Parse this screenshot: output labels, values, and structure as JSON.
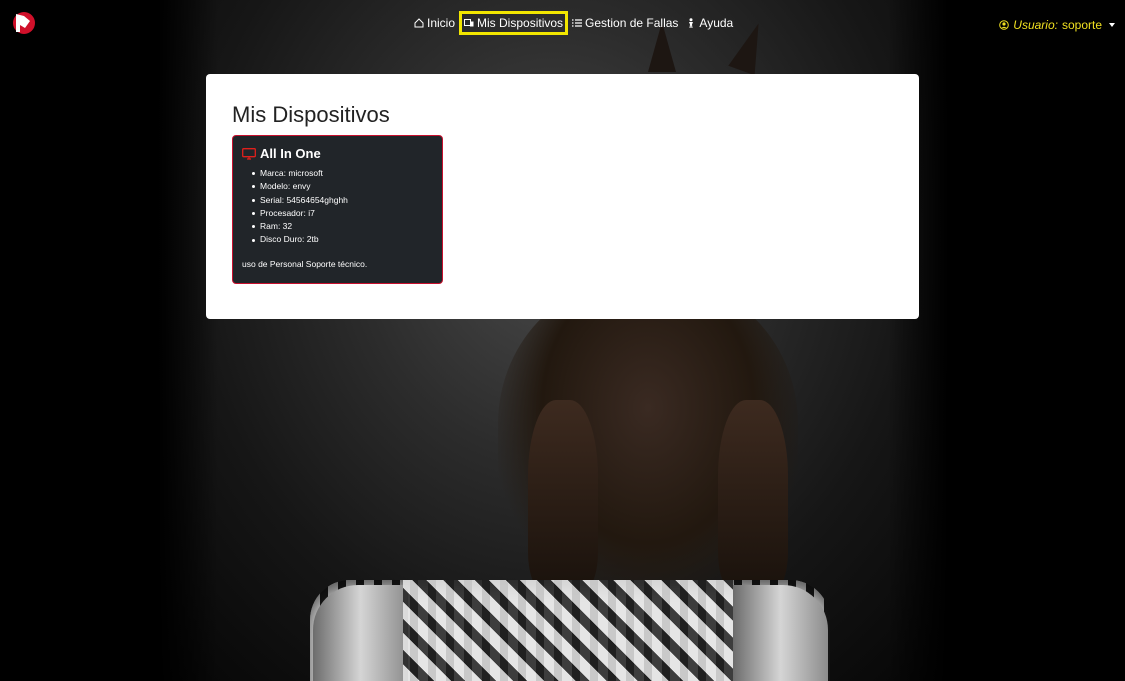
{
  "nav": {
    "links": [
      {
        "label": "Inicio",
        "icon": "home-icon"
      },
      {
        "label": "Mis Dispositivos",
        "icon": "devices-icon",
        "active": true
      },
      {
        "label": "Gestion de Fallas",
        "icon": "list-icon"
      },
      {
        "label": "Ayuda",
        "icon": "person-icon"
      }
    ],
    "user": {
      "prefix": "Usuario:",
      "name": "soporte"
    }
  },
  "main": {
    "title": "Mis Dispositivos",
    "device": {
      "name": "All In One",
      "icon": "monitor-icon",
      "specs": [
        "Marca: microsoft",
        "Modelo: envy",
        "Serial: 54564654ghghh",
        "Procesador: i7",
        "Ram: 32",
        "Disco Duro: 2tb"
      ],
      "description": "uso de Personal Soporte técnico."
    }
  },
  "colors": {
    "accent_yellow": "#f2e600",
    "brand_red": "#c8102e",
    "card_bg": "#212529"
  }
}
